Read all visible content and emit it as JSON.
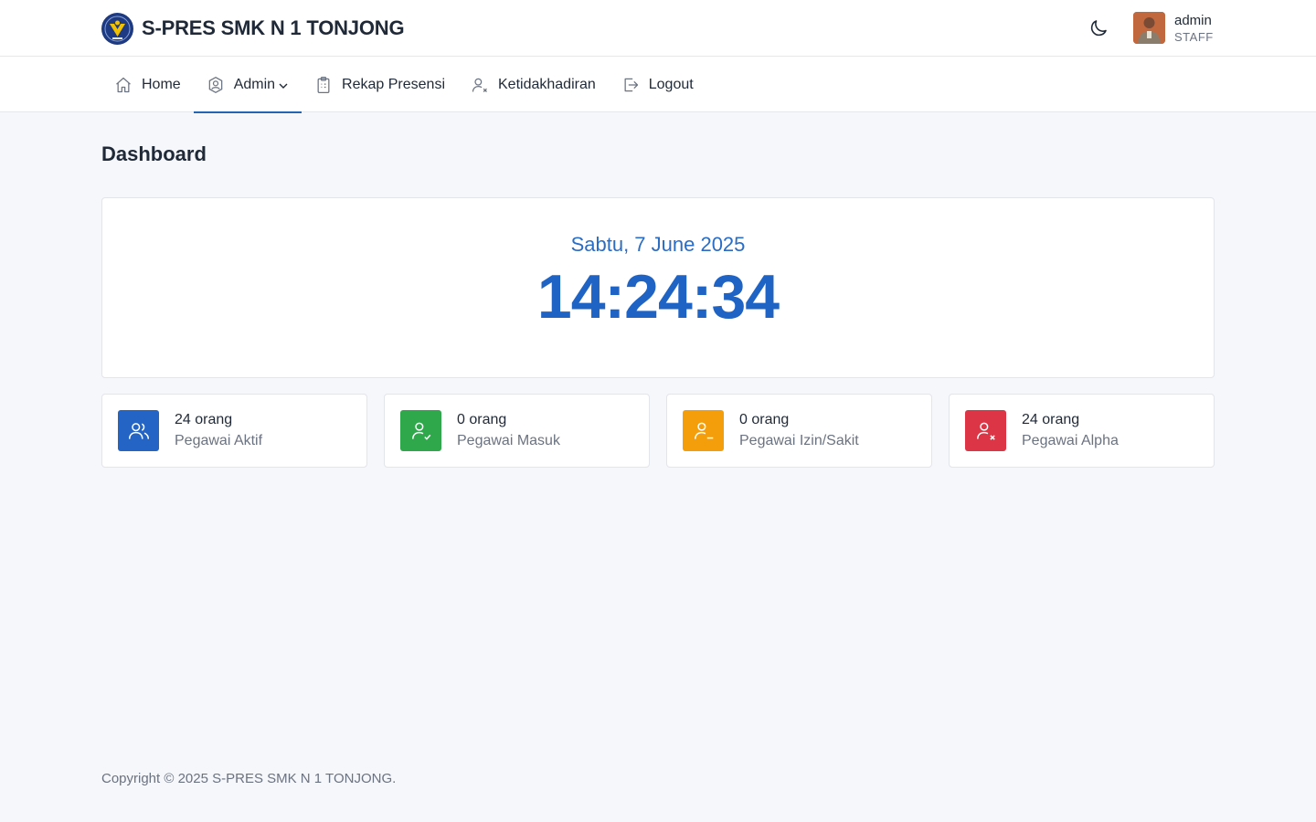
{
  "header": {
    "title": "S-PRES SMK N 1 TONJONG",
    "theme_icon": "moon-icon",
    "user": {
      "name": "admin",
      "role": "STAFF"
    }
  },
  "nav": {
    "items": [
      {
        "label": "Home",
        "icon": "home-icon"
      },
      {
        "label": "Admin",
        "icon": "user-shield-icon",
        "active": true,
        "dropdown": true
      },
      {
        "label": "Rekap Presensi",
        "icon": "clipboard-icon"
      },
      {
        "label": "Ketidakhadiran",
        "icon": "user-x-icon"
      },
      {
        "label": "Logout",
        "icon": "logout-icon"
      }
    ]
  },
  "page": {
    "title": "Dashboard"
  },
  "clock": {
    "date": "Sabtu, 7 June 2025",
    "time": "14:24:34"
  },
  "stats": [
    {
      "count": "24 orang",
      "label": "Pegawai Aktif",
      "color": "#2364c4",
      "icon": "users-icon"
    },
    {
      "count": "0 orang",
      "label": "Pegawai Masuk",
      "color": "#2ea84a",
      "icon": "user-check-icon"
    },
    {
      "count": "0 orang",
      "label": "Pegawai Izin/Sakit",
      "color": "#f59e0b",
      "icon": "user-minus-icon"
    },
    {
      "count": "24 orang",
      "label": "Pegawai Alpha",
      "color": "#dc3545",
      "icon": "user-x-icon"
    }
  ],
  "footer": {
    "text": "Copyright © 2025 S-PRES SMK N 1 TONJONG."
  },
  "colors": {
    "accent": "#2364b4",
    "clock": "#1f63c4",
    "background": "#f5f7fb"
  }
}
